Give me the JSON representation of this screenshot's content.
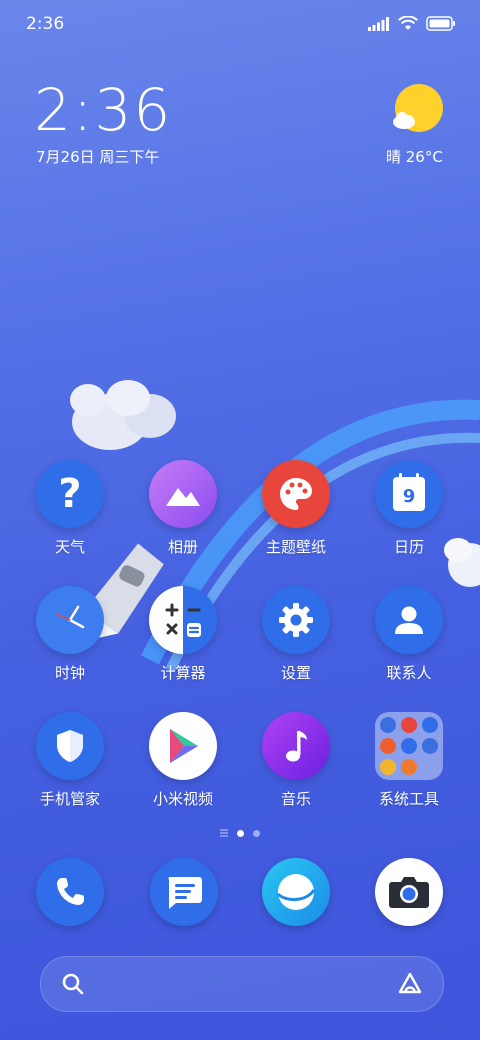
{
  "status_bar": {
    "time": "2:36"
  },
  "clock_widget": {
    "time": "2:36",
    "date": "7月26日 周三下午"
  },
  "weather_widget": {
    "text": "晴 26°C"
  },
  "apps": {
    "row1": [
      "天气",
      "相册",
      "主题壁纸",
      "日历"
    ],
    "row2": [
      "时钟",
      "计算器",
      "设置",
      "联系人"
    ],
    "row3": [
      "手机管家",
      "小米视频",
      "音乐",
      "系统工具"
    ]
  },
  "calendar_day": "9",
  "page_indicator": {
    "pages": 2,
    "active": 1
  },
  "dock": [
    "phone-icon",
    "messages-icon",
    "browser-icon",
    "camera-icon"
  ],
  "colors": {
    "accent_blue": "#2f6ee8",
    "purple": "#a05cf0",
    "red": "#e8453c",
    "music_purple": "#7c2ee8"
  }
}
